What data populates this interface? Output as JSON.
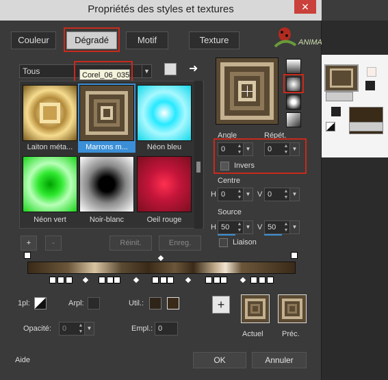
{
  "window": {
    "title": "Propriétés des styles et textures",
    "close_label": "✕"
  },
  "tabs": [
    {
      "label": "Couleur"
    },
    {
      "label": "Dégradé"
    },
    {
      "label": "Motif"
    },
    {
      "label": "Texture"
    }
  ],
  "watermark": "ANIMABELLE",
  "gradient_filter": {
    "value": "Tous"
  },
  "tooltip": "Corel_06_035",
  "swatches": [
    {
      "label": "Laiton méta..."
    },
    {
      "label": "Marrons m..."
    },
    {
      "label": "Néon bleu"
    },
    {
      "label": "Néon vert"
    },
    {
      "label": "Noir-blanc"
    },
    {
      "label": "Oeil rouge"
    }
  ],
  "left_buttons": {
    "add": "+",
    "remove": "-",
    "reset": "Réinit.",
    "save": "Enreg."
  },
  "angle": {
    "label": "Angle",
    "value": "0"
  },
  "repeat": {
    "label": "Répét.",
    "value": "0"
  },
  "invert": {
    "label": "Invers"
  },
  "center": {
    "label": "Centre",
    "h_label": "H",
    "h_value": "0",
    "v_label": "V",
    "v_value": "0"
  },
  "source": {
    "label": "Source",
    "h_label": "H",
    "h_value": "50",
    "v_label": "V",
    "v_value": "50"
  },
  "link": {
    "label": "Liaison"
  },
  "stop_props": {
    "onepl_label": "1pl:",
    "arpl_label": "Arpl:",
    "util_label": "Util.:",
    "opacity_label": "Opacité:",
    "opacity_value": "0",
    "empl_label": "Empl.:",
    "empl_value": "0"
  },
  "preview": {
    "current_label": "Actuel",
    "previous_label": "Préc.",
    "add_label": "+"
  },
  "footer": {
    "help": "Aide",
    "ok": "OK",
    "cancel": "Annuler"
  },
  "colors": {
    "accent_red": "#c92a1b",
    "selection_blue": "#3b8fd6",
    "brown_dark": "#3a2a18",
    "brown_light": "#d9c4a2"
  }
}
